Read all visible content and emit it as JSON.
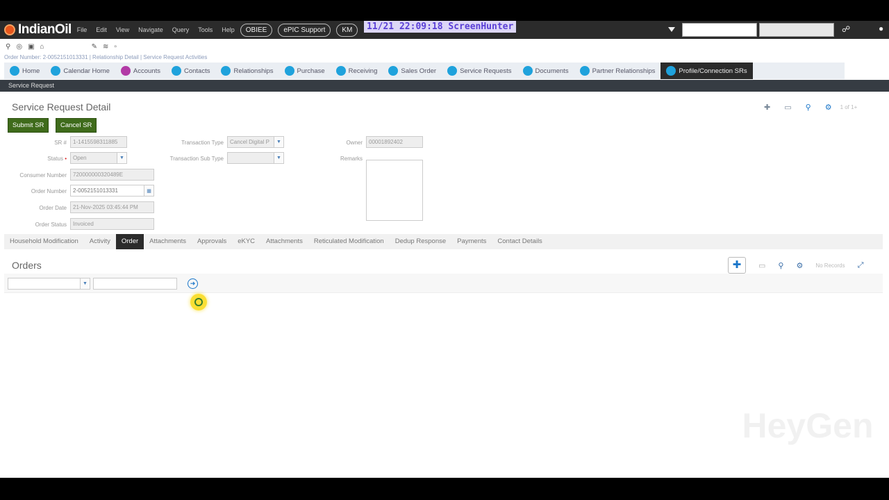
{
  "app": {
    "logo_text": "IndianOil",
    "menu": [
      "File",
      "Edit",
      "View",
      "Navigate",
      "Query",
      "Tools",
      "Help"
    ],
    "pills": [
      "OBIEE",
      "ePIC Support",
      "KM"
    ],
    "overlay_text": "11/21  22:09:18  ScreenHunter"
  },
  "breadcrumb": "Order Number: 2-0052151013331  |  Relationship Detail  |  Service Request Activities",
  "tabs": [
    {
      "label": "Home"
    },
    {
      "label": "Calendar Home"
    },
    {
      "label": "Accounts"
    },
    {
      "label": "Contacts"
    },
    {
      "label": "Relationships"
    },
    {
      "label": "Purchase"
    },
    {
      "label": "Receiving"
    },
    {
      "label": "Sales Order"
    },
    {
      "label": "Service Requests"
    },
    {
      "label": "Documents"
    },
    {
      "label": "Partner Relationships"
    },
    {
      "label": "Profile/Connection SRs"
    }
  ],
  "service_bar": "Service Request",
  "detail": {
    "title": "Service Request Detail",
    "record_count": "1 of 1+",
    "submit_label": "Submit SR",
    "cancel_label": "Cancel SR",
    "fields": {
      "sr_label": "SR #",
      "sr_value": "1-1415598311885",
      "status_label": "Status",
      "status_value": "Open",
      "consumer_label": "Consumer Number",
      "consumer_value": "720000000320489E",
      "order_number_label": "Order Number",
      "order_number_value": "2-0052151013331",
      "order_date_label": "Order Date",
      "order_date_value": "21-Nov-2025 03:45:44 PM",
      "order_status_label": "Order Status",
      "order_status_value": "Invoiced",
      "transaction_type_label": "Transaction Type",
      "transaction_type_value": "Cancel Digital P",
      "transaction_sub_type_label": "Transaction Sub Type",
      "transaction_sub_type_value": "",
      "owner_label": "Owner",
      "owner_value": "00001892402",
      "remarks_label": "Remarks"
    }
  },
  "subtabs": [
    {
      "label": "Household Modification"
    },
    {
      "label": "Activity"
    },
    {
      "label": "Order"
    },
    {
      "label": "Attachments"
    },
    {
      "label": "Approvals"
    },
    {
      "label": "eKYC"
    },
    {
      "label": "Attachments"
    },
    {
      "label": "Reticulated Modification"
    },
    {
      "label": "Dedup Response"
    },
    {
      "label": "Payments"
    },
    {
      "label": "Contact Details"
    }
  ],
  "orders": {
    "title": "Orders",
    "no_records": "No Records"
  },
  "watermark": "HeyGen"
}
